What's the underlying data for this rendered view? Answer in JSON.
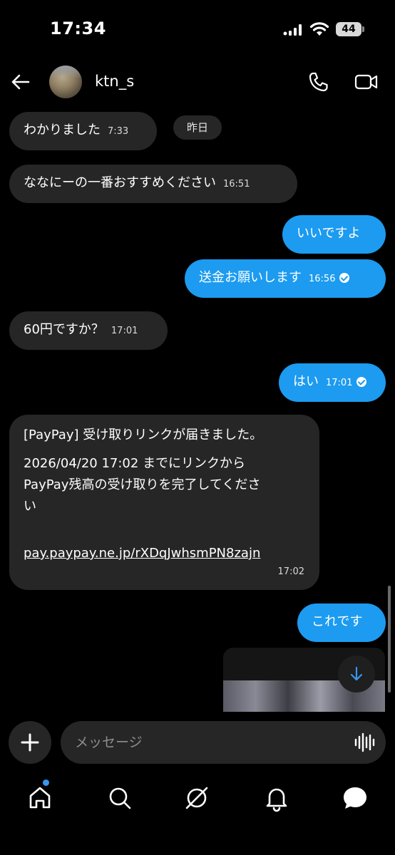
{
  "status_bar": {
    "time": "17:34",
    "battery": "44"
  },
  "header": {
    "username": "ktn_s"
  },
  "messages": {
    "m1": {
      "text": "わかりました",
      "time": "7:33"
    },
    "day": "昨日",
    "m2": {
      "text": "ななにーの一番おすすめください",
      "time": "16:51"
    },
    "m3": {
      "text": "いいですよ"
    },
    "m4": {
      "text": "送金お願いします",
      "time": "16:56"
    },
    "m5": {
      "text": "60円ですか？",
      "time": "17:01"
    },
    "m6": {
      "text": "はい",
      "time": "17:01"
    },
    "paypay": {
      "line1": "[PayPay] 受け取りリンクが届きました。",
      "line2": "2026/04/20 17:02 までにリンクから",
      "line3": "PayPay残高の受け取りを完了してくださ",
      "line4": "い",
      "link": "pay.paypay.ne.jp/rXDqJwhsmPN8zajn",
      "time": "17:02"
    },
    "m7": {
      "text": "これです"
    }
  },
  "composer": {
    "placeholder": "メッセージ"
  },
  "icons": [
    "back-arrow-icon",
    "phone-icon",
    "video-camera-icon",
    "plus-icon",
    "voice-wave-icon",
    "arrow-down-icon",
    "home-icon",
    "search-icon",
    "explore-icon",
    "bell-icon",
    "chat-bubble-icon"
  ],
  "colors": {
    "outgoing_bubble": "#1c9bf0",
    "incoming_bubble": "#262626",
    "background": "#000000",
    "notification_dot": "#3897f0"
  }
}
